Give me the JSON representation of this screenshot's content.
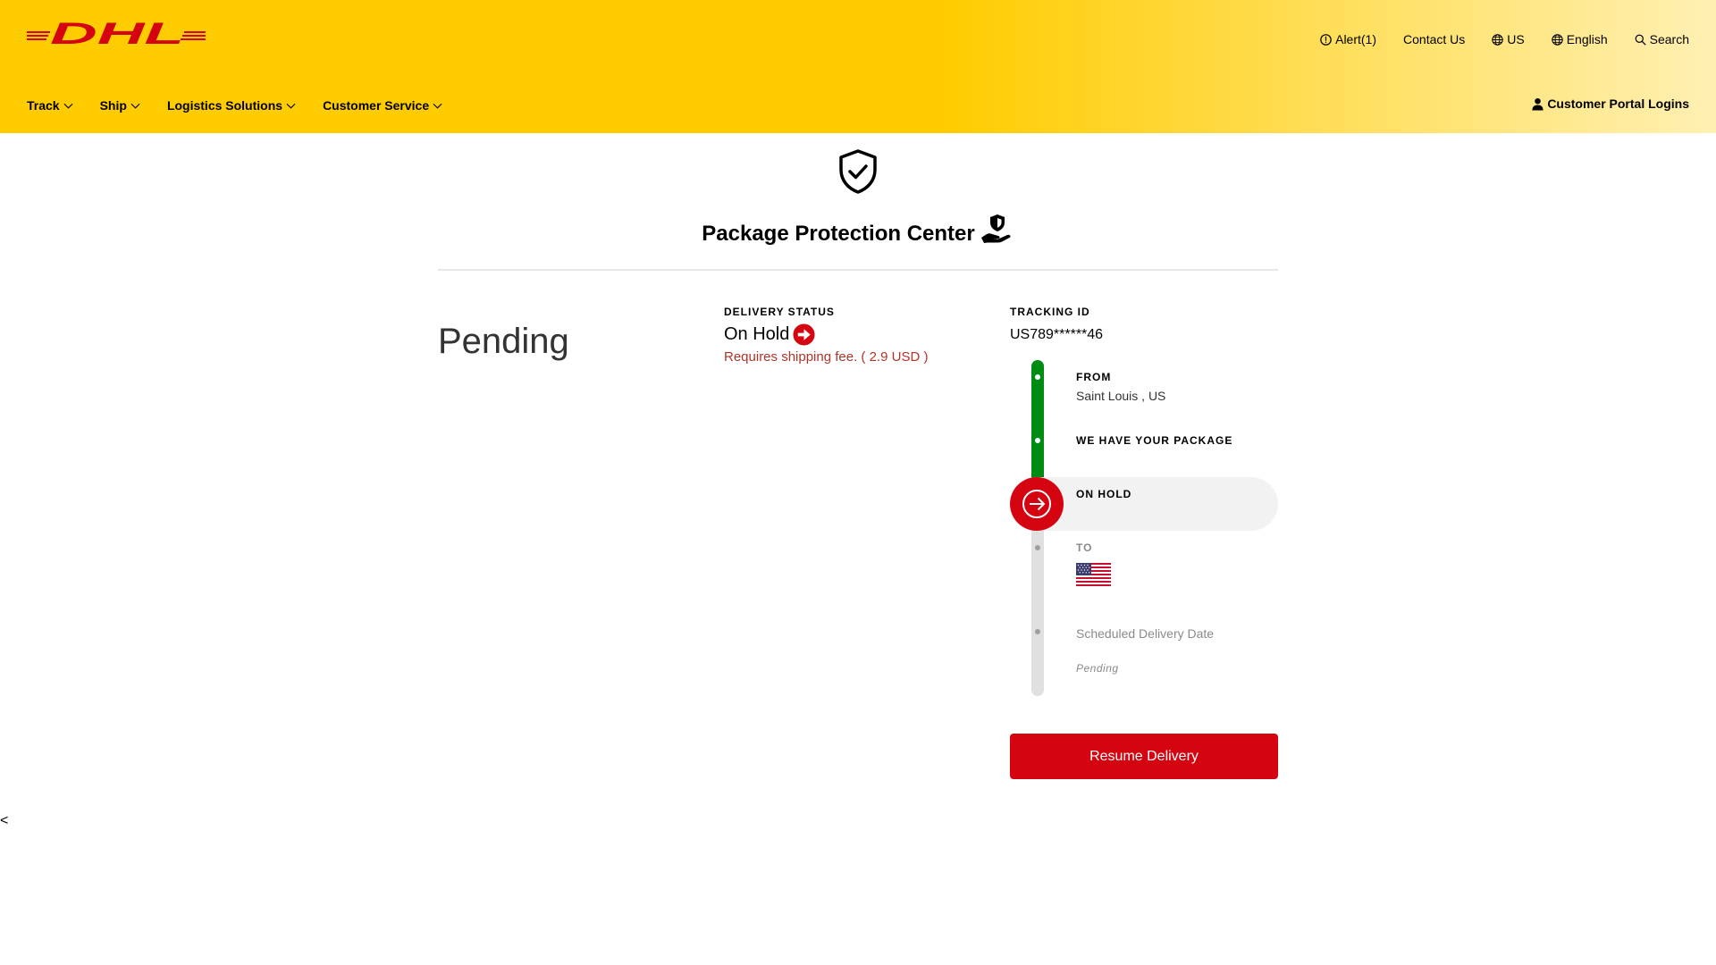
{
  "brand": {
    "logo_text": "DHL",
    "logo_color": "#d40511",
    "header_color": "#ffcc00"
  },
  "utility_nav": {
    "alert": "Alert(1)",
    "contact": "Contact Us",
    "country": "US",
    "language": "English",
    "search": "Search"
  },
  "main_nav": {
    "items": [
      {
        "label": "Track"
      },
      {
        "label": "Ship"
      },
      {
        "label": "Logistics Solutions"
      },
      {
        "label": "Customer Service"
      }
    ],
    "portal": "Customer Portal Logins"
  },
  "page": {
    "title": "Package Protection Center",
    "status_big": "Pending"
  },
  "delivery": {
    "label": "DELIVERY STATUS",
    "value": "On Hold",
    "note": "Requires shipping fee. ( 2.9 USD )"
  },
  "tracking": {
    "label": "TRACKING ID",
    "value": "US789******46"
  },
  "timeline": {
    "from_label": "FROM",
    "from_value": "Saint Louis , US",
    "step2": "WE HAVE YOUR PACKAGE",
    "step3": "ON HOLD",
    "to_label": "TO",
    "to_flag": "us-flag-icon",
    "scheduled_label": "Scheduled Delivery Date",
    "scheduled_value": "Pending"
  },
  "colors": {
    "green": "#008b13",
    "red": "#d40511",
    "note_red": "#b0342a"
  },
  "actions": {
    "resume": "Resume Delivery"
  },
  "footer": {
    "back_char": "<"
  }
}
